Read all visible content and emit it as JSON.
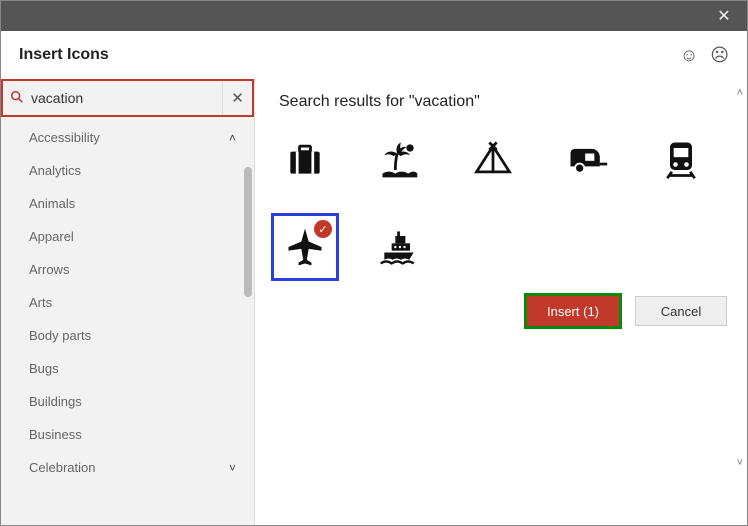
{
  "dialog": {
    "title": "Insert Icons"
  },
  "search": {
    "value": "vacation",
    "placeholder": "Search icons"
  },
  "categories": [
    "Accessibility",
    "Analytics",
    "Animals",
    "Apparel",
    "Arrows",
    "Arts",
    "Body parts",
    "Bugs",
    "Buildings",
    "Business",
    "Celebration"
  ],
  "results": {
    "heading": "Search results for \"vacation\"",
    "icons": [
      {
        "name": "suitcase-icon",
        "selected": false
      },
      {
        "name": "palm-beach-icon",
        "selected": false
      },
      {
        "name": "tent-icon",
        "selected": false
      },
      {
        "name": "camper-icon",
        "selected": false
      },
      {
        "name": "train-icon",
        "selected": false
      },
      {
        "name": "airplane-icon",
        "selected": true
      },
      {
        "name": "cruise-ship-icon",
        "selected": false
      }
    ],
    "selected_count": 1
  },
  "footer": {
    "insert_label": "Insert (1)",
    "cancel_label": "Cancel"
  }
}
